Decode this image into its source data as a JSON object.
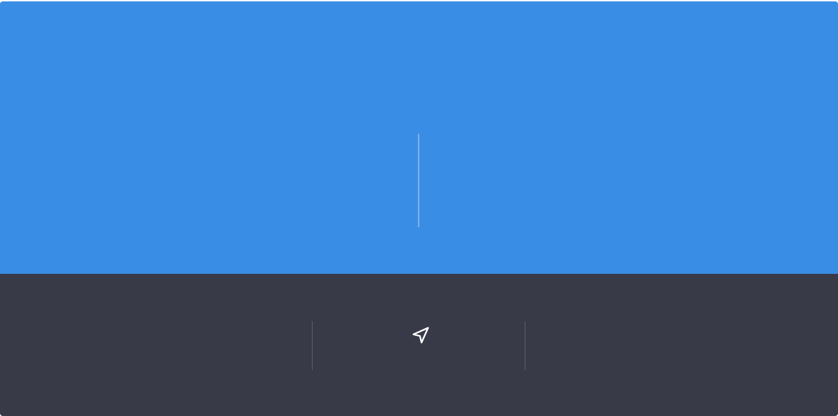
{
  "colors": {
    "top_panel": "#3a8de5",
    "bottom_panel": "#393a48",
    "icon": "#ffffff"
  },
  "icons": {
    "navigation": "navigation-arrow-icon"
  }
}
